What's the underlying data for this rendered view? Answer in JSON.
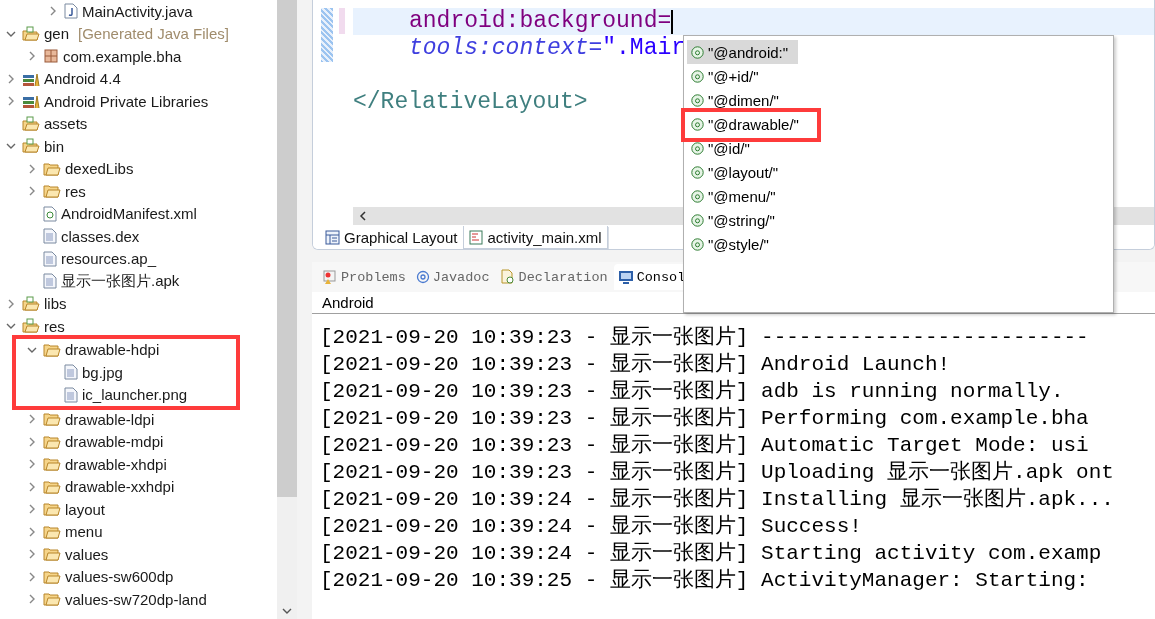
{
  "tree": {
    "items": [
      {
        "children": [
          {
            "children": [
              {
                "label": "MainActivity.java",
                "kind": "java",
                "expanded": false
              }
            ]
          }
        ]
      },
      {
        "label": "gen",
        "decoration": "[Generated Java Files]",
        "kind": "source-folder",
        "expanded": true,
        "children": [
          {
            "label": "com.example.bha",
            "kind": "package",
            "expanded": false
          }
        ]
      },
      {
        "label": "Android 4.4",
        "kind": "library",
        "expanded": false
      },
      {
        "label": "Android Private Libraries",
        "kind": "library",
        "expanded": false
      },
      {
        "label": "assets",
        "kind": "source-folder"
      },
      {
        "label": "bin",
        "kind": "source-folder",
        "expanded": true,
        "children": [
          {
            "label": "dexedLibs",
            "kind": "folder",
            "expanded": false
          },
          {
            "label": "res",
            "kind": "folder",
            "expanded": false
          },
          {
            "label": "AndroidManifest.xml",
            "kind": "xml"
          },
          {
            "label": "classes.dex",
            "kind": "file"
          },
          {
            "label": "resources.ap_",
            "kind": "file"
          },
          {
            "label": "显示一张图片.apk",
            "kind": "file"
          }
        ]
      },
      {
        "label": "libs",
        "kind": "source-folder",
        "expanded": false
      },
      {
        "label": "res",
        "kind": "source-folder",
        "expanded": true,
        "children": [
          {
            "label": "drawable-hdpi",
            "kind": "folder",
            "expanded": true,
            "highlighted": true,
            "children": [
              {
                "label": "bg.jpg",
                "kind": "file"
              },
              {
                "label": "ic_launcher.png",
                "kind": "file"
              }
            ]
          },
          {
            "label": "drawable-ldpi",
            "kind": "folder",
            "expanded": false
          },
          {
            "label": "drawable-mdpi",
            "kind": "folder",
            "expanded": false
          },
          {
            "label": "drawable-xhdpi",
            "kind": "folder",
            "expanded": false
          },
          {
            "label": "drawable-xxhdpi",
            "kind": "folder",
            "expanded": false
          },
          {
            "label": "layout",
            "kind": "folder",
            "expanded": false
          },
          {
            "label": "menu",
            "kind": "folder",
            "expanded": false
          },
          {
            "label": "values",
            "kind": "folder",
            "expanded": false
          },
          {
            "label": "values-sw600dp",
            "kind": "folder",
            "expanded": false
          },
          {
            "label": "values-sw720dp-land",
            "kind": "folder",
            "expanded": false
          }
        ]
      }
    ]
  },
  "editor": {
    "lines": [
      {
        "kind": "attribute",
        "current": true,
        "parts": [
          {
            "text": "android:background=",
            "kind": "attr"
          }
        ]
      },
      {
        "kind": "attribute",
        "current": false,
        "parts": [
          {
            "text": "tools:context=",
            "kind": "attr-italic"
          },
          {
            "text": "\".Mair",
            "kind": "value"
          }
        ]
      },
      {
        "kind": "blank",
        "current": false
      },
      {
        "kind": "tag",
        "current": false,
        "parts": [
          {
            "text": "</RelativeLayout>",
            "kind": "tag"
          }
        ]
      }
    ],
    "tabs": [
      {
        "label": "Graphical Layout",
        "kind": "layout",
        "selected": false
      },
      {
        "label": "activity_main.xml",
        "kind": "xml",
        "selected": true
      }
    ]
  },
  "completion": {
    "items": [
      {
        "label": "\"@android:\"",
        "selected": true,
        "highlighted": false
      },
      {
        "label": "\"@+id/\"",
        "selected": false,
        "highlighted": false
      },
      {
        "label": "\"@dimen/\"",
        "selected": false,
        "highlighted": false
      },
      {
        "label": "\"@drawable/\"",
        "selected": false,
        "highlighted": true
      },
      {
        "label": "\"@id/\"",
        "selected": false,
        "highlighted": false
      },
      {
        "label": "\"@layout/\"",
        "selected": false,
        "highlighted": false
      },
      {
        "label": "\"@menu/\"",
        "selected": false,
        "highlighted": false
      },
      {
        "label": "\"@string/\"",
        "selected": false,
        "highlighted": false
      },
      {
        "label": "\"@style/\"",
        "selected": false,
        "highlighted": false
      }
    ]
  },
  "panel": {
    "tabs": [
      {
        "label": "Problems",
        "kind": "problems",
        "selected": false
      },
      {
        "label": "Javadoc",
        "kind": "javadoc",
        "selected": false
      },
      {
        "label": "Declaration",
        "kind": "declaration",
        "selected": false
      },
      {
        "label": "Consol",
        "kind": "console",
        "selected": true
      }
    ],
    "console_title": "Android",
    "lines": [
      {
        "prefix": "[2021-09-20 10:39:23 - 显示一张图片]",
        "message": "--------------------------"
      },
      {
        "prefix": "[2021-09-20 10:39:23 - 显示一张图片]",
        "message": "Android Launch!"
      },
      {
        "prefix": "[2021-09-20 10:39:23 - 显示一张图片]",
        "message": "adb is running normally."
      },
      {
        "prefix": "[2021-09-20 10:39:23 - 显示一张图片]",
        "message": "Performing com.example.bha"
      },
      {
        "prefix": "[2021-09-20 10:39:23 - 显示一张图片]",
        "message": "Automatic Target Mode: usi"
      },
      {
        "prefix": "[2021-09-20 10:39:23 - 显示一张图片]",
        "message": "Uploading 显示一张图片.apk ont"
      },
      {
        "prefix": "[2021-09-20 10:39:24 - 显示一张图片]",
        "message": "Installing 显示一张图片.apk..."
      },
      {
        "prefix": "[2021-09-20 10:39:24 - 显示一张图片]",
        "message": "Success!"
      },
      {
        "prefix": "[2021-09-20 10:39:24 - 显示一张图片]",
        "message": "Starting activity com.examp"
      },
      {
        "prefix": "[2021-09-20 10:39:25 - 显示一张图片]",
        "message": "ActivityManager: Starting:"
      }
    ]
  }
}
